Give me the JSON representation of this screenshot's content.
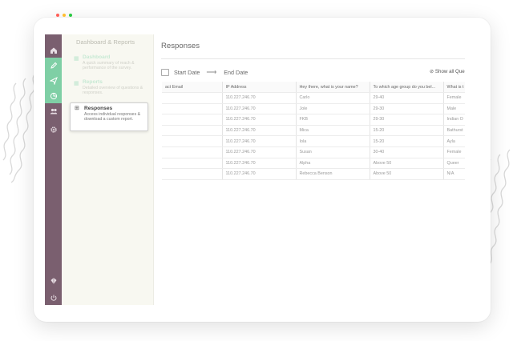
{
  "nav_rail": {
    "items": [
      {
        "name": "home-icon"
      },
      {
        "name": "pen-icon",
        "active": true
      },
      {
        "name": "send-icon",
        "active": true
      },
      {
        "name": "chart-icon",
        "active": true
      },
      {
        "name": "users-icon"
      },
      {
        "name": "gear-icon"
      },
      {
        "name": "logo-icon"
      },
      {
        "name": "power-icon"
      }
    ]
  },
  "sub_nav": {
    "title": "Dashboard & Reports",
    "items": [
      {
        "title": "Dashboard",
        "desc": "A quick summary of reach & performance of the survey."
      },
      {
        "title": "Reports",
        "desc": "Detailed overview of questions & responses."
      },
      {
        "title": "Responses",
        "desc": "Access individual responses & download a custom report."
      }
    ]
  },
  "main": {
    "title": "Responses",
    "start_date": "Start Date",
    "end_date": "End Date",
    "show_all": "Show all Que"
  },
  "table": {
    "columns": [
      "act Email",
      "IP Address",
      "Hey there, what is your name?",
      "To which age group do you bel...",
      "What is t"
    ],
    "rows": [
      [
        "",
        "110.227.246.70",
        "Carlo",
        "29-40",
        "Female"
      ],
      [
        "",
        "110.227.246.70",
        "Jole",
        "29-30",
        "Male"
      ],
      [
        "",
        "110.227.246.70",
        "FKB",
        "29-30",
        "Indian O"
      ],
      [
        "",
        "110.227.246.70",
        "Mica",
        "15-20",
        "Bathurst"
      ],
      [
        "",
        "110.227.246.70",
        "Iola",
        "15-20",
        "Ayla"
      ],
      [
        "",
        "110.227.246.70",
        "Susan",
        "30-40",
        "Female"
      ],
      [
        "",
        "110.227.246.70",
        "Alpha",
        "Above 50",
        "Queer"
      ],
      [
        "",
        "110.227.246.70",
        "Rebecca Benson",
        "Above 50",
        "N/A"
      ]
    ]
  },
  "colors": {
    "rail": "#7a5f6f",
    "rail_active": "#7fcfa5",
    "accent_green": "#4fbf83",
    "subnav_bg": "#f8f8f1",
    "wave": "#d9d9d9"
  },
  "window_dots": [
    "#ff5f57",
    "#ffbd2e",
    "#28c840"
  ]
}
